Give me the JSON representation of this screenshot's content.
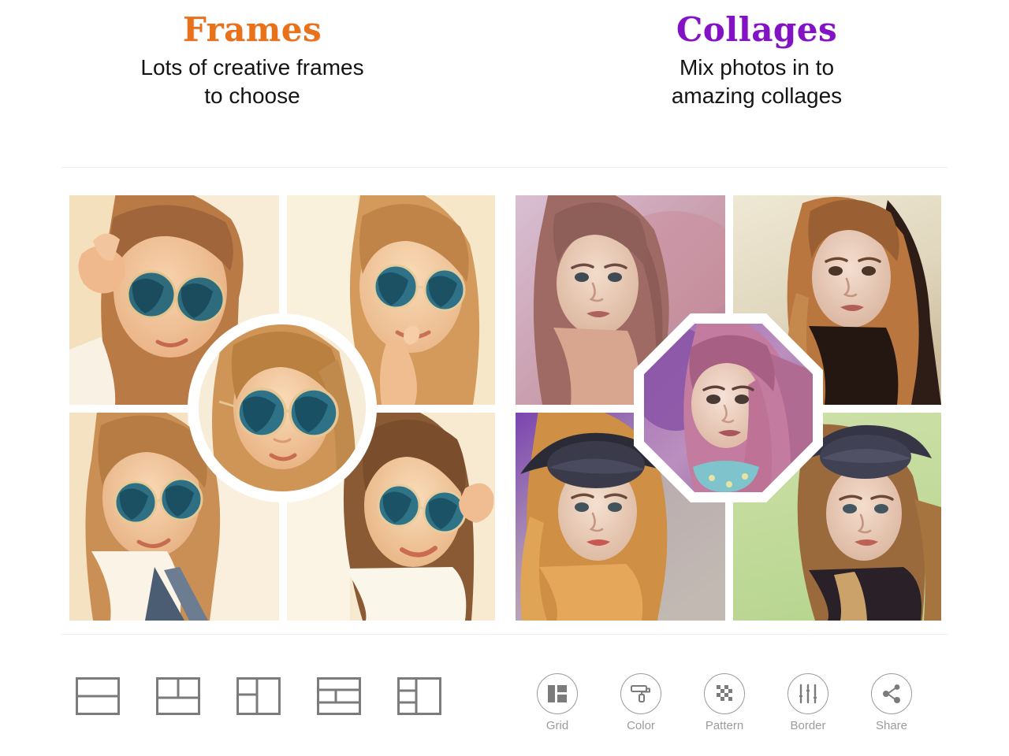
{
  "headings": [
    {
      "title": "Frames",
      "title_color": "#e8711a",
      "subtitle": "Lots of creative frames\nto choose"
    },
    {
      "title": "Collages",
      "title_color": "#8312c4",
      "subtitle": "Mix photos in to\namazing collages"
    }
  ],
  "collages": {
    "left": {
      "name": "frames-collage",
      "overlay_shape": "circle",
      "tint": "warm-sepia-orange",
      "cells": [
        {
          "alt": "woman-with-round-sunglasses-hand-raised"
        },
        {
          "alt": "woman-with-round-sunglasses-finger-on-lips"
        },
        {
          "alt": "woman-with-round-sunglasses-denim-straps"
        },
        {
          "alt": "woman-with-round-sunglasses-looking-up"
        }
      ],
      "overlay_cell": {
        "alt": "woman-with-round-sunglasses-center-portrait"
      }
    },
    "right": {
      "name": "collages-collage",
      "overlay_shape": "octagon",
      "tint": "purple-green",
      "cells": [
        {
          "alt": "woman-long-hair-purple-tint-portrait"
        },
        {
          "alt": "woman-dark-coat-warm-tint-portrait"
        },
        {
          "alt": "woman-with-hat-purple-tint-portrait"
        },
        {
          "alt": "woman-with-hat-green-background-portrait"
        }
      ],
      "overlay_cell": {
        "alt": "woman-pink-purple-hair-center-portrait"
      }
    }
  },
  "layout_bar": {
    "name": "frame-layout-picker",
    "items": [
      {
        "name": "layout-2-rows",
        "label": "2 rows"
      },
      {
        "name": "layout-two-top-one-bottom",
        "label": "2 top 1 bottom"
      },
      {
        "name": "layout-left-split-right-full",
        "label": "left split right full"
      },
      {
        "name": "layout-three-rows-middle-split",
        "label": "3 rows middle split"
      },
      {
        "name": "layout-three-left-one-right",
        "label": "3 left 1 right"
      }
    ]
  },
  "tool_bar": {
    "name": "collage-tools",
    "items": [
      {
        "label": "Grid",
        "icon": "grid-icon"
      },
      {
        "label": "Color",
        "icon": "paint-roller-icon"
      },
      {
        "label": "Pattern",
        "icon": "checker-pattern-icon"
      },
      {
        "label": "Border",
        "icon": "sliders-icon"
      },
      {
        "label": "Share",
        "icon": "share-icon"
      }
    ]
  },
  "colors": {
    "frames_accent": "#e8711a",
    "collages_accent": "#8312c4",
    "tool_gray": "#9b9b9b",
    "separator": "#f0f0f0",
    "background": "#ffffff"
  }
}
